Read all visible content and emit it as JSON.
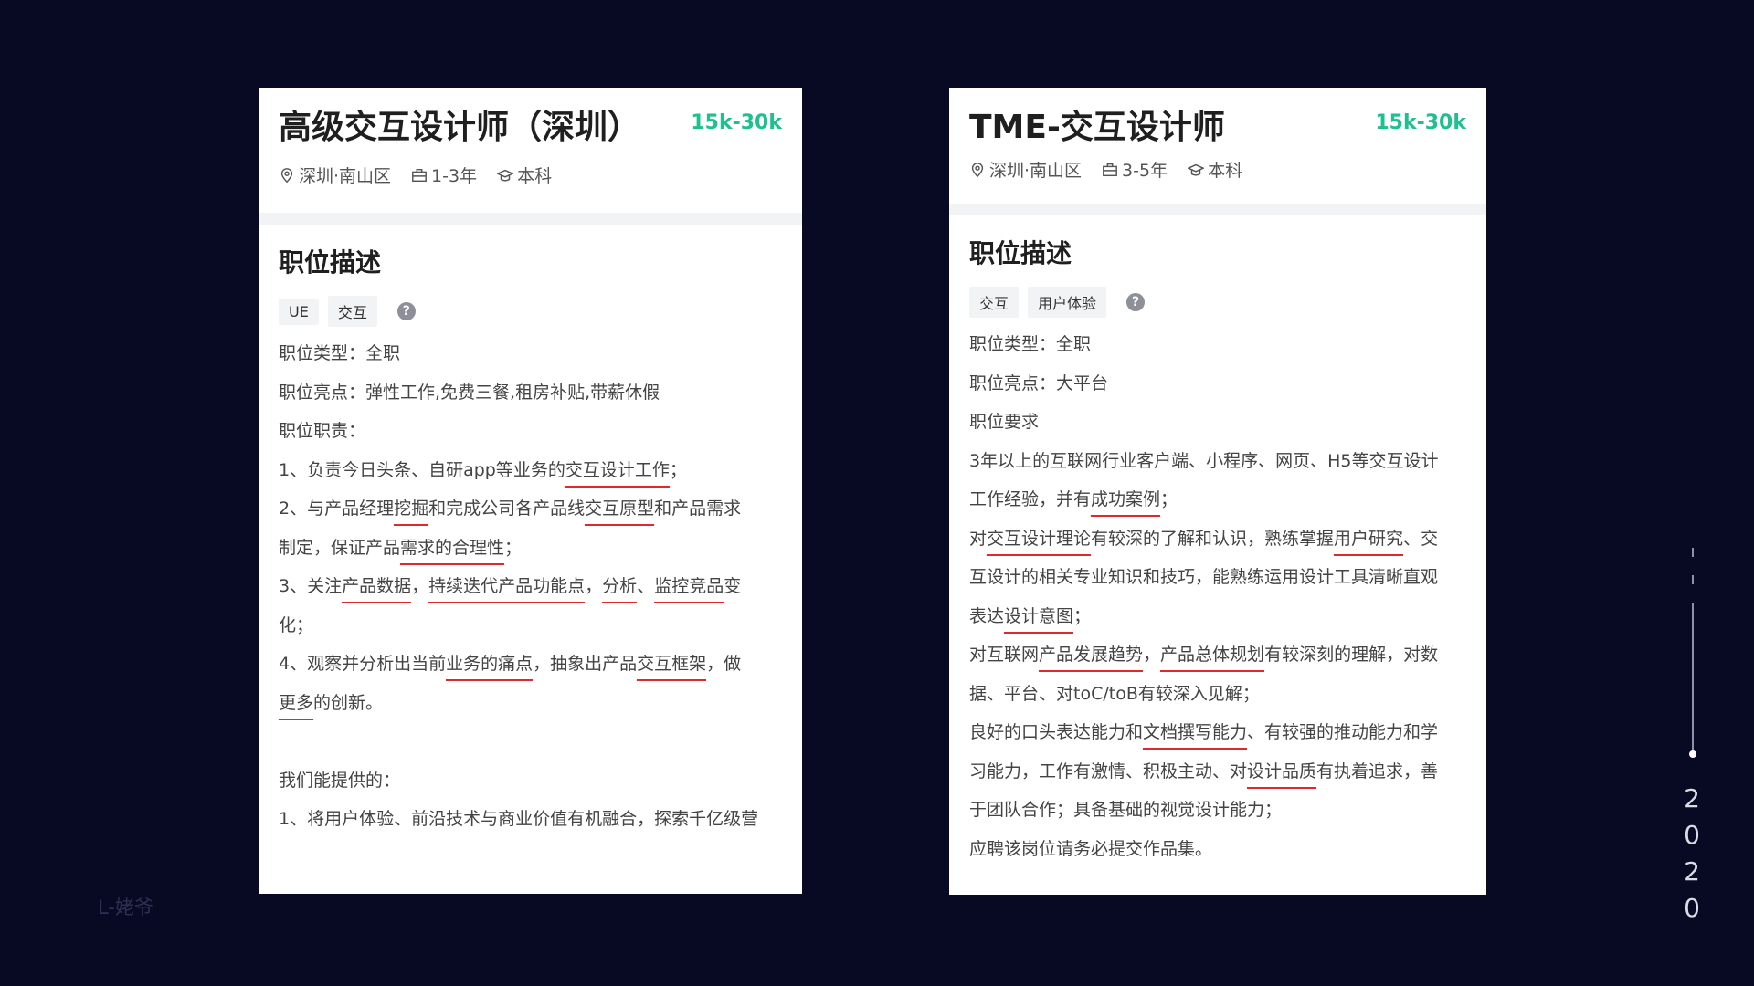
{
  "cards": [
    {
      "title": "高级交互设计师（深圳）",
      "salary": "15k-30k",
      "location": "深圳·南山区",
      "experience": "1-3年",
      "education": "本科",
      "section_title": "职位描述",
      "tags": [
        "UE",
        "交互"
      ],
      "help": "?",
      "lines": [
        "职位类型：全职",
        "职位亮点：弹性工作,免费三餐,租房补贴,带薪休假",
        "职位职责：",
        "1、负责今日头条、自研app等业务的交互设计工作；",
        "2、与产品经理挖掘和完成公司各产品线交互原型和产品需求",
        "制定，保证产品需求的合理性；",
        "3、关注产品数据，持续迭代产品功能点，分析、监控竞品变",
        "化；",
        "4、观察并分析出当前业务的痛点，抽象出产品交互框架，做",
        "更多的创新。",
        "",
        "我们能提供的：",
        "1、将用户体验、前沿技术与商业价值有机融合，探索千亿级营"
      ]
    },
    {
      "title": "TME-交互设计师",
      "salary": "15k-30k",
      "location": "深圳·南山区",
      "experience": "3-5年",
      "education": "本科",
      "section_title": "职位描述",
      "tags": [
        "交互",
        "用户体验"
      ],
      "help": "?",
      "lines": [
        "职位类型：全职",
        "职位亮点：大平台",
        "职位要求",
        "3年以上的互联网行业客户端、小程序、网页、H5等交互设计",
        "工作经验，并有成功案例；",
        "对交互设计理论有较深的了解和认识，熟练掌握用户研究、交",
        "互设计的相关专业知识和技巧，能熟练运用设计工具清晰直观",
        "表达设计意图；",
        "对互联网产品发展趋势，产品总体规划有较深刻的理解，对数",
        "据、平台、对toC/toB有较深入见解；",
        "良好的口头表达能力和文档撰写能力、有较强的推动能力和学",
        "习能力，工作有激情、积极主动、对设计品质有执着追求，善",
        "于团队合作；具备基础的视觉设计能力；",
        "应聘该岗位请务必提交作品集。"
      ]
    }
  ],
  "watermark": "L-姥爷",
  "year_digits": [
    "2",
    "0",
    "2",
    "0"
  ]
}
